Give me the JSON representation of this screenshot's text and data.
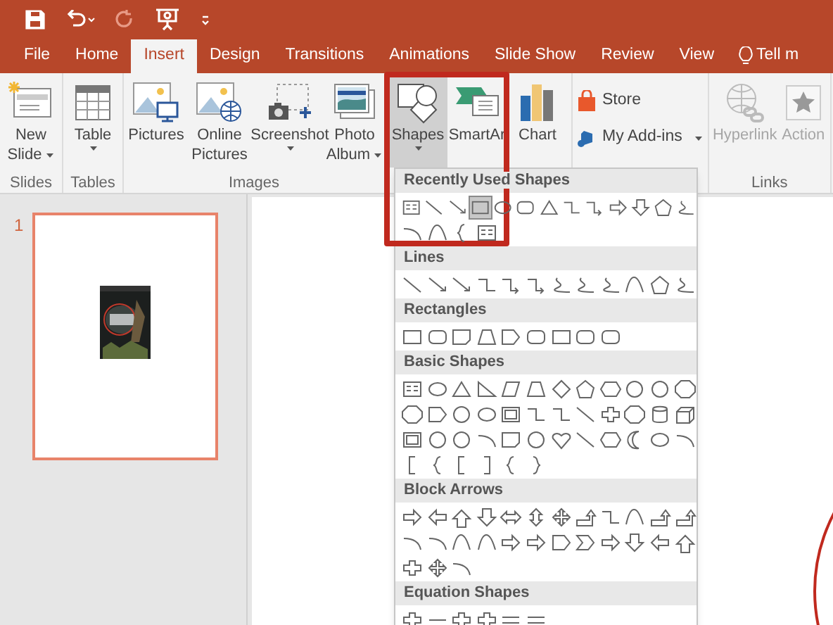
{
  "quick_access": [
    {
      "kind": "save",
      "disabled": false
    },
    {
      "kind": "undo",
      "disabled": false
    },
    {
      "kind": "redo",
      "disabled": true
    },
    {
      "kind": "present",
      "disabled": false
    },
    {
      "kind": "customize",
      "disabled": false
    }
  ],
  "tabs": [
    {
      "label": "File",
      "selected": false
    },
    {
      "label": "Home",
      "selected": false
    },
    {
      "label": "Insert",
      "selected": true
    },
    {
      "label": "Design",
      "selected": false
    },
    {
      "label": "Transitions",
      "selected": false
    },
    {
      "label": "Animations",
      "selected": false
    },
    {
      "label": "Slide Show",
      "selected": false
    },
    {
      "label": "Review",
      "selected": false
    },
    {
      "label": "View",
      "selected": false
    }
  ],
  "tell_me": {
    "label": "Tell m"
  },
  "ribbon": {
    "groups": [
      {
        "label": "Slides",
        "buttons": [
          {
            "kind": "new-slide",
            "lines": [
              "New",
              "Slide"
            ],
            "dropdown": true,
            "selected": false,
            "disabled": false
          }
        ]
      },
      {
        "label": "Tables",
        "buttons": [
          {
            "kind": "table",
            "lines": [
              "Table"
            ],
            "dropdown": true,
            "selected": false,
            "disabled": false
          }
        ]
      },
      {
        "label": "Images",
        "buttons": [
          {
            "kind": "pictures",
            "lines": [
              "Pictures"
            ],
            "dropdown": false,
            "selected": false,
            "disabled": false
          },
          {
            "kind": "online-pictures",
            "lines": [
              "Online",
              "Pictures"
            ],
            "dropdown": false,
            "selected": false,
            "disabled": false
          },
          {
            "kind": "screenshot",
            "lines": [
              "Screenshot"
            ],
            "dropdown": true,
            "selected": false,
            "disabled": false
          },
          {
            "kind": "photo-album",
            "lines": [
              "Photo",
              "Album"
            ],
            "dropdown": true,
            "selected": false,
            "disabled": false
          }
        ]
      },
      {
        "buttons": [
          {
            "kind": "shapes",
            "lines": [
              "Shapes"
            ],
            "dropdown": true,
            "selected": true,
            "disabled": false
          },
          {
            "kind": "smartart",
            "lines": [
              "SmartAr"
            ],
            "dropdown": false,
            "selected": false,
            "disabled": false
          },
          {
            "kind": "chart",
            "lines": [
              "Chart"
            ],
            "dropdown": false,
            "selected": false,
            "disabled": false
          }
        ]
      },
      {
        "small_buttons": [
          {
            "kind": "store",
            "label": "Store",
            "dropdown": false
          },
          {
            "kind": "add-ins",
            "label": "My Add-ins",
            "dropdown": true
          }
        ]
      },
      {
        "label": "Links",
        "buttons": [
          {
            "kind": "hyperlink",
            "lines": [
              "Hyperlink"
            ],
            "dropdown": false,
            "selected": false,
            "disabled": true
          },
          {
            "kind": "action",
            "lines": [
              "Action"
            ],
            "dropdown": false,
            "selected": false,
            "disabled": true
          }
        ]
      }
    ]
  },
  "slides": [
    {
      "number": "1",
      "selected": true
    }
  ],
  "shapes_gallery": {
    "sections": [
      {
        "title": "Recently Used Shapes",
        "shapes": [
          {
            "selected": false
          },
          {
            "selected": false
          },
          {
            "selected": false
          },
          {
            "selected": true
          },
          {
            "selected": false
          },
          {
            "selected": false
          },
          {
            "selected": false
          },
          {
            "selected": false
          },
          {
            "selected": false
          },
          {
            "selected": false
          },
          {
            "selected": false
          },
          {
            "selected": false
          },
          {
            "selected": false
          },
          {
            "selected": false
          },
          {
            "selected": false
          },
          {
            "selected": false
          },
          {
            "selected": false
          }
        ]
      },
      {
        "title": "Lines"
      },
      {
        "title": "Rectangles"
      },
      {
        "title": "Basic Shapes"
      },
      {
        "title": "Block Arrows"
      },
      {
        "title": "Equation Shapes"
      }
    ]
  }
}
